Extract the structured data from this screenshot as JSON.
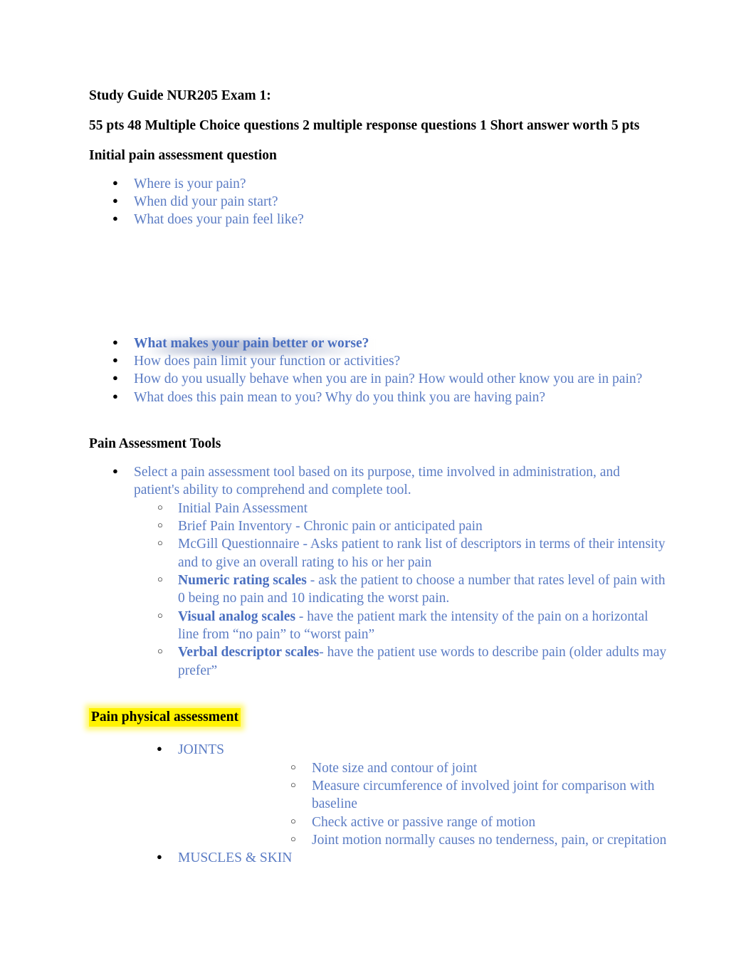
{
  "document": {
    "title": "Study Guide NUR205 Exam 1:",
    "subtitle": "55 pts 48 Multiple Choice questions 2 multiple response questions 1 Short answer worth 5 pts",
    "section_initial": {
      "heading": "Initial pain assessment question",
      "questions_top": [
        "Where is your pain?",
        "When did your pain start?",
        "What does your pain feel like?"
      ],
      "questions_bottom": [
        "What makes your pain better or worse?",
        "How does pain limit your function or activities?",
        "How do you usually behave when you are in pain? How would other know you are in pain?",
        "What does this pain mean to you? Why do you think you are having pain?"
      ]
    },
    "section_tools": {
      "heading": "Pain Assessment Tools",
      "intro": "Select a pain assessment tool based on its purpose, time involved in administration, and patient's ability to comprehend and complete tool.",
      "tools": [
        {
          "bold": "",
          "text": "Initial Pain Assessment"
        },
        {
          "bold": "",
          "text": "Brief Pain Inventory - Chronic pain or anticipated pain"
        },
        {
          "bold": "",
          "text": "McGill Questionnaire - Asks patient to rank list of descriptors in terms of their intensity and to give an overall rating to his or her pain"
        },
        {
          "bold": "Numeric rating scales",
          "text": " - ask the patient to choose a number that rates level of pain with 0 being no pain and 10 indicating the worst pain."
        },
        {
          "bold": "Visual analog scales",
          "text": " - have the patient mark the intensity of the pain on a horizontal line from “no pain” to “worst pain”"
        },
        {
          "bold": "Verbal descriptor scales",
          "text": "- have the patient use words to describe pain (older adults may prefer”"
        }
      ]
    },
    "section_physical": {
      "heading": "Pain physical assessment",
      "heading_highlight_color": "#fff200",
      "groups": [
        {
          "label": "JOINTS",
          "items": [
            "Note size and contour of joint",
            "Measure circumference of involved joint for comparison with baseline",
            "Check active or passive range of motion",
            "Joint motion normally causes no tenderness, pain, or crepitation"
          ]
        },
        {
          "label": "MUSCLES & SKIN",
          "items": []
        }
      ]
    }
  }
}
